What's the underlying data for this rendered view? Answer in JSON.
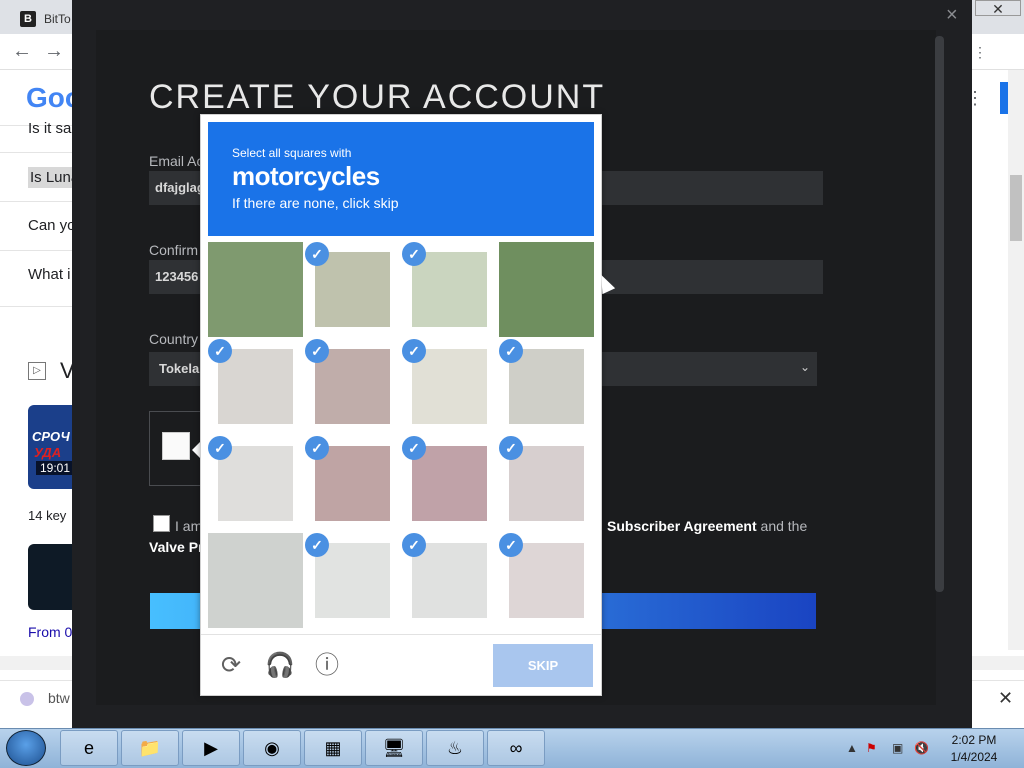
{
  "browser": {
    "tab_title": "BitTo",
    "tab_icon_letter": "B",
    "window_close": "✕"
  },
  "background_page": {
    "google_logo": "Goo",
    "list_items": [
      "Is it sa",
      "Is Luna",
      "Can yo",
      "What i"
    ],
    "section_letter": "V",
    "thumb_text_1": "СРОЧ",
    "thumb_text_2": "УДА",
    "thumb_time": "19:01",
    "key_text": "14 key",
    "from_text": "From 0",
    "bottom_text": "btw",
    "bottom_close": "✕"
  },
  "modal": {
    "close": "×",
    "title": "CREATE YOUR ACCOUNT",
    "email_label": "Email Ac",
    "email_value": "dfajglag",
    "confirm_label": "Confirm",
    "confirm_value": "123456",
    "country_label": "Country",
    "country_value": "Tokelau",
    "agree_text_start": "I am",
    "agree_link_1": "Subscriber Agreement",
    "agree_and_the": "and the",
    "agree_link_2": "Valve Pr"
  },
  "challenge": {
    "line1": "Select all squares with",
    "line2": "motorcycles",
    "line3": "If there are none, click skip",
    "tiles": [
      {
        "selected": false,
        "color": "#7f9a6f"
      },
      {
        "selected": true,
        "color": "#8a8f6a"
      },
      {
        "selected": true,
        "color": "#9fb38a"
      },
      {
        "selected": false,
        "color": "#6f8f5f"
      },
      {
        "selected": true,
        "color": "#b9b4ad"
      },
      {
        "selected": true,
        "color": "#8d6a64"
      },
      {
        "selected": true,
        "color": "#c9c7b5"
      },
      {
        "selected": true,
        "color": "#a7a79a"
      },
      {
        "selected": true,
        "color": "#c5c3c0"
      },
      {
        "selected": true,
        "color": "#8a5a5a"
      },
      {
        "selected": true,
        "color": "#8c5560"
      },
      {
        "selected": true,
        "color": "#b6a8a8"
      },
      {
        "selected": false,
        "color": "#cfd2cf"
      },
      {
        "selected": true,
        "color": "#c9ccc9"
      },
      {
        "selected": true,
        "color": "#c6c8c6"
      },
      {
        "selected": true,
        "color": "#c2b5b5"
      }
    ],
    "check_glyph": "✓",
    "refresh_icon": "⟳",
    "audio_icon": "🎧",
    "info_icon": "ⓘ",
    "skip_label": "SKIP"
  },
  "taskbar": {
    "apps": [
      "e",
      "📁",
      "▶",
      "◉",
      "▦",
      "🖥",
      "♨",
      "∞"
    ],
    "time": "2:02 PM",
    "date": "1/4/2024",
    "tray_arrow": "▲",
    "tray_flag": "⚑",
    "tray_net": "▣",
    "tray_vol": "🔇"
  }
}
